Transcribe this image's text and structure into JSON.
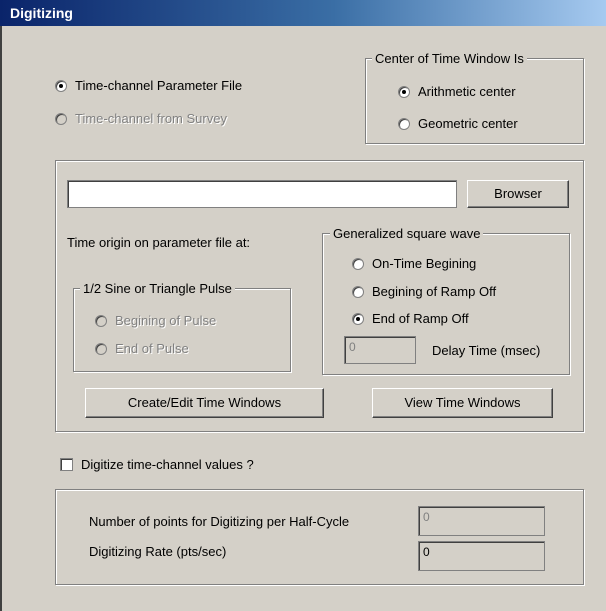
{
  "window": {
    "title": "Digitizing"
  },
  "source": {
    "parameter_file": "Time-channel Parameter File",
    "from_survey": "Time-channel from Survey"
  },
  "center_group": {
    "legend": "Center of Time Window Is",
    "arithmetic": "Arithmetic center",
    "geometric": "Geometric center"
  },
  "file": {
    "path_value": "",
    "browse_label": "Browser"
  },
  "time_origin_label": "Time origin on parameter file at:",
  "sine_group": {
    "legend": "1/2 Sine or Triangle Pulse",
    "begin": "Begining of Pulse",
    "end": "End of Pulse"
  },
  "square_group": {
    "legend": "Generalized square wave",
    "on_time": "On-Time Begining",
    "ramp_begin": "Begining of Ramp Off",
    "ramp_end": "End of Ramp Off",
    "delay_value": "0",
    "delay_label": "Delay Time (msec)"
  },
  "buttons": {
    "create_edit": "Create/Edit Time Windows",
    "view": "View Time Windows"
  },
  "digitize": {
    "checkbox_label": "Digitize time-channel values ?",
    "points_label": "Number of points for Digitizing per Half-Cycle",
    "points_value": "0",
    "rate_label": "Digitizing Rate (pts/sec)",
    "rate_value": "0"
  }
}
